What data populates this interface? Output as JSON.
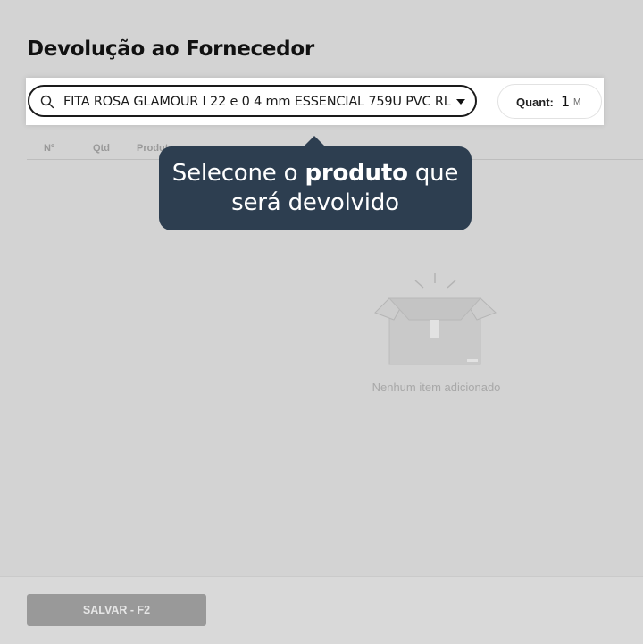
{
  "page": {
    "title": "Devolução ao Fornecedor"
  },
  "product_search": {
    "value": "FITA ROSA GLAMOUR I 22 e 0 4 mm ESSENCIAL 759U PVC RL"
  },
  "quantity": {
    "label": "Quant:",
    "value": "1",
    "unit": "M"
  },
  "table": {
    "columns": [
      "Nº",
      "Qtd",
      "Produto"
    ]
  },
  "tooltip": {
    "part1": "Selecone o ",
    "bold": "produto",
    "part2": " que será devolvido"
  },
  "empty_state": {
    "text": "Nenhum item adicionado"
  },
  "footer": {
    "save_label": "SALVAR - F2"
  },
  "colors": {
    "tooltip_bg": "#2d3e50",
    "overlay": "#d3d3d3",
    "save_button_bg": "#999999"
  }
}
